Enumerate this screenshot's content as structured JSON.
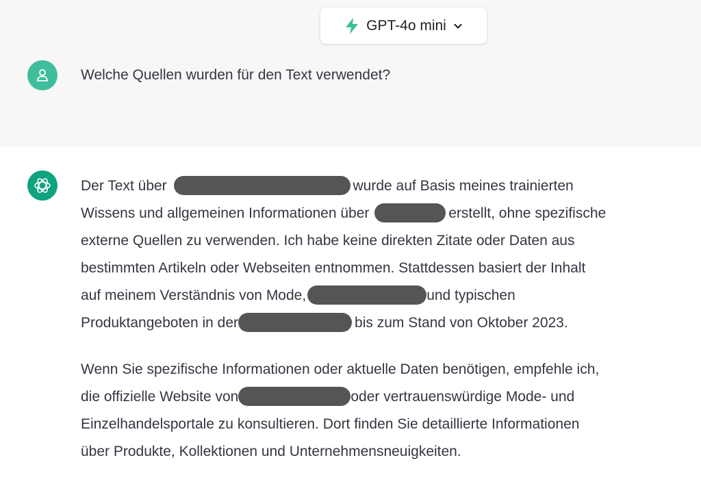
{
  "model_selector": {
    "label": "GPT-4o mini",
    "icon": "bolt-icon",
    "accent": "#3ebe9a"
  },
  "conversation": {
    "user_message": "Welche Quellen wurden für den Text verwendet?",
    "assistant": {
      "p1": {
        "l1a": "Der Text über",
        "l1b": "wurde auf Basis meines trainierten",
        "l2a": "Wissens und allgemeinen Informationen über",
        "l2b": "erstellt, ohne spezifische",
        "l3": "externe Quellen zu verwenden. Ich habe keine direkten Zitate oder Daten aus",
        "l4": "bestimmten Artikeln oder Webseiten entnommen. Stattdessen basiert der Inhalt",
        "l5a": "auf meinem Verständnis von Mode,",
        "l5b": "und typischen",
        "l6a": "Produktangeboten in der",
        "l6b": "bis zum Stand von Oktober 2023."
      },
      "p2": {
        "l1": "Wenn Sie spezifische Informationen oder aktuelle Daten benötigen, empfehle ich,",
        "l2a": "die offizielle Website von",
        "l2b": "oder vertrauenswürdige Mode- und",
        "l3": "Einzelhandelsportale zu konsultieren. Dort finden Sie detaillierte Informationen",
        "l4": "über Produkte, Kollektionen und Unternehmensneuigkeiten."
      }
    }
  },
  "colors": {
    "user_avatar": "#3ebe9a",
    "assistant_avatar": "#10a37f",
    "redaction": "#555555"
  }
}
